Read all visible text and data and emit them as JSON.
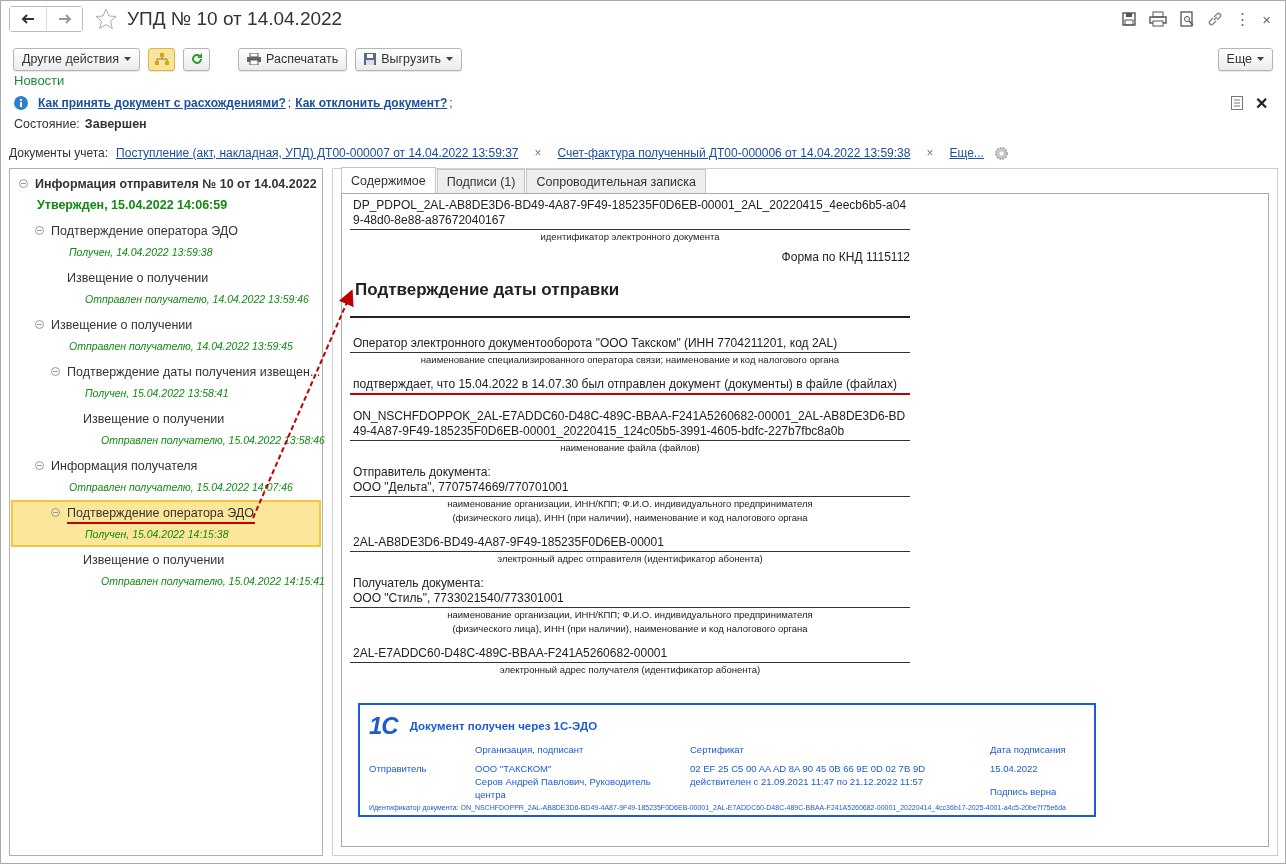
{
  "window": {
    "title": "УПД № 10 от 14.04.2022",
    "favorite": false,
    "close": "×",
    "more": "⋮"
  },
  "toolbar": {
    "buttons": [
      {
        "kind": "dropdown",
        "label": "Другие действия"
      },
      {
        "kind": "structure"
      },
      {
        "kind": "refresh"
      },
      {
        "kind": "print",
        "label": "Распечатать"
      },
      {
        "kind": "export",
        "label": "Выгрузить"
      }
    ],
    "more": "Еще"
  },
  "news": {
    "title": "Новости",
    "links": [
      {
        "label": "Как принять документ с расхождениями?",
        "suffix": ";"
      },
      {
        "label": "Как отклонить документ?",
        "suffix": ";"
      }
    ],
    "close": "✕"
  },
  "state": {
    "label": "Состояние:",
    "value": "Завершен"
  },
  "accounting_docs": {
    "label": "Документы учета:",
    "links": [
      {
        "label": "Поступление (акт, накладная, УПД) ДТ00-000007 от 14.04.2022 13:59:37",
        "remove": "×"
      },
      {
        "label": "Счет-фактура полученный ДТ00-000006 от 14.04.2022 13:59:38",
        "remove": "×"
      }
    ],
    "more": "Еще..."
  },
  "tree": [
    {
      "title": "Информация отправителя № 10 от 14.04.2022",
      "status": "Утвержден, 15.04.2022 14:06:59",
      "expanded": true,
      "selected": false,
      "children": [
        {
          "title": "Подтверждение оператора ЭДО",
          "status": "Получен, 14.04.2022 13:59:38",
          "expanded": true,
          "selected": false,
          "children": [
            {
              "title": "Извещение о получении",
              "status": "Отправлен получателю, 14.04.2022 13:59:46",
              "selected": false
            }
          ]
        },
        {
          "title": "Извещение о получении",
          "status": "Отправлен получателю, 14.04.2022 13:59:45",
          "expanded": true,
          "selected": false,
          "children": [
            {
              "title": "Подтверждение даты получения извещен...",
              "status": "Получен, 15.04.2022 13:58:41",
              "expanded": true,
              "selected": false,
              "children": [
                {
                  "title": "Извещение о получении",
                  "status": "Отправлен получателю, 15.04.2022 13:58:46",
                  "selected": false
                }
              ]
            }
          ]
        },
        {
          "title": "Информация получателя",
          "status": "Отправлен получателю, 15.04.2022 14:07:46",
          "expanded": true,
          "selected": false,
          "children": [
            {
              "title": "Подтверждение оператора ЭДО",
              "status": "Получен, 15.04.2022 14:15:38",
              "expanded": true,
              "selected": true,
              "children": [
                {
                  "title": "Извещение о получении",
                  "status": "Отправлен получателю, 15.04.2022 14:15:41",
                  "selected": false
                }
              ]
            }
          ]
        }
      ]
    }
  ],
  "tabs": [
    {
      "label": "Содержимое",
      "selected": true
    },
    {
      "label": "Подписи (1)",
      "selected": false
    },
    {
      "label": "Сопроводительная записка",
      "selected": false
    }
  ],
  "document": {
    "id": "DP_PDPOL_2AL-AB8DE3D6-BD49-4A87-9F49-185235F0D6EB-00001_2AL_20220415_4eecb6b5-a049-48d0-8e88-a87672040167",
    "id_caption": [
      "идентификатор электронного документа"
    ],
    "form": "Форма по КНД 1115112",
    "heading": "Подтверждение даты отправки",
    "operator": "Оператор электронного документооборота \"ООО Такском\" (ИНН 7704211201, код 2AL)",
    "operator_caption": [
      "наименование специализированного оператора связи; наименование и код налогового органа"
    ],
    "statement": "подтверждает, что 15.04.2022 в 14.07.30 был отправлен документ (документы) в файле (файлах)",
    "file_name": "ON_NSCHFDOPPOK_2AL-E7ADDC60-D48C-489C-BBAA-F241A5260682-00001_2AL-AB8DE3D6-BD49-4A87-9F49-185235F0D6EB-00001_20220415_124c05b5-3991-4605-bdfc-227b7fbc8a0b",
    "file_caption": [
      "наименование файла (файлов)"
    ],
    "sender_label": "Отправитель документа:",
    "sender": "ООО \"Дельта\", 7707574669/770701001",
    "sender_caption": [
      "наименование организации, ИНН/КПП; Ф.И.О. индивидуального предпринимателя",
      "(физического лица), ИНН (при наличии), наименование и код налогового органа"
    ],
    "sender_address": "2AL-AB8DE3D6-BD49-4A87-9F49-185235F0D6EB-00001",
    "sender_address_caption": [
      "электронный адрес отправителя (идентификатор абонента)"
    ],
    "recipient_label": "Получатель документа:",
    "recipient": "ООО \"Стиль\", 7733021540/773301001",
    "recipient_caption": [
      "наименование организации, ИНН/КПП; Ф.И.О. индивидуального предпринимателя",
      "(физического лица), ИНН (при наличии), наименование и код налогового органа"
    ],
    "recipient_address": "2AL-E7ADDC60-D48C-489C-BBAA-F241A5260682-00001",
    "recipient_address_caption": [
      "электронный адрес получателя (идентификатор абонента)"
    ]
  },
  "stamp": {
    "logo": "1С",
    "title": "Документ получен через 1С-ЭДО",
    "headers": [
      "Организация, подписант",
      "Сертификат",
      "Дата подписания"
    ],
    "role": "Отправитель",
    "organization": "ООО \"ТАКСКОМ\"",
    "signer": "Серов Андрей Павлович, Руководитель центра",
    "certificate": "02 EF 25 C5 00 AA AD 8A 90 45 0B 66 9E 0D 02 7B 9D",
    "validity": "действителен с 21.09.2021 11:47 по 21.12.2022 11:57",
    "date": "15.04.2022",
    "verdict": "Подпись верна",
    "doc_id": "Идентификатор документа: ON_NSCHFDOPPR_2AL-AB8DE3D6-BD49-4A87-9F49-185235F0D6EB-00001_2AL-E7ADDC60-D48C-489C-BBAA-F241A5260682-00001_20220414_4cc36b17-2025-4001-a4c5-20be7f75e6da"
  }
}
